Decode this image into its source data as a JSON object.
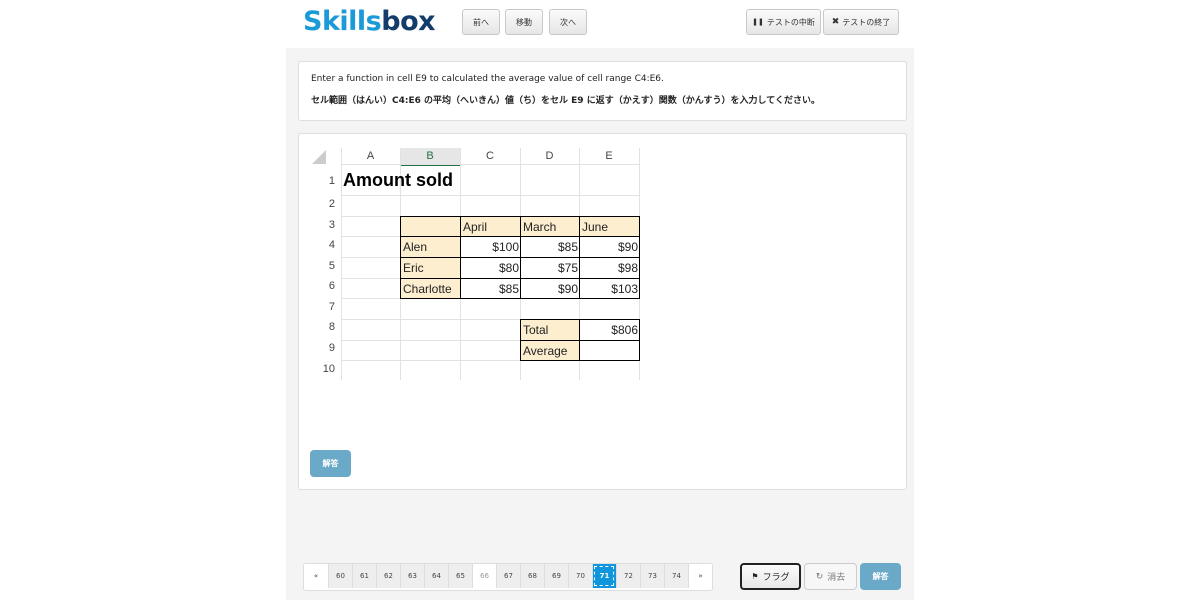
{
  "header": {
    "logo_part1": "Skills",
    "logo_part2": "box",
    "prev_label": "前へ",
    "move_label": "移動",
    "next_label": "次へ",
    "pause_label": "テストの中断",
    "end_label": "テストの終了"
  },
  "question": {
    "english": "Enter a function in cell E9 to calculated the average value of cell range C4:E6.",
    "japanese": "セル範囲（はんい）C4:E6 の平均（へいきん）値（ち）をセル E9 に返す（かえす）関数（かんすう）を入力してください。"
  },
  "sheet": {
    "columns": [
      "A",
      "B",
      "C",
      "D",
      "E"
    ],
    "rows": [
      "1",
      "2",
      "3",
      "4",
      "5",
      "6",
      "7",
      "8",
      "9",
      "10"
    ],
    "title": "Amount sold",
    "month_headers": [
      "April",
      "March",
      "June"
    ],
    "names": [
      "Alen",
      "Eric",
      "Charlotte"
    ],
    "values": [
      [
        "$100",
        "$85",
        "$90"
      ],
      [
        "$80",
        "$75",
        "$98"
      ],
      [
        "$85",
        "$90",
        "$103"
      ]
    ],
    "total_label": "Total",
    "total_value": "$806",
    "average_label": "Average"
  },
  "answer_button_label": "解答",
  "pager": {
    "prev": "«",
    "pages": [
      "60",
      "61",
      "62",
      "63",
      "64",
      "65",
      "66",
      "67",
      "68",
      "69",
      "70",
      "71",
      "72",
      "73",
      "74"
    ],
    "current": "71",
    "next": "»"
  },
  "footer": {
    "flag_label": "フラグ",
    "clear_label": "消去",
    "answer_label": "解答"
  },
  "colors": {
    "brand_light": "#1a9ad6",
    "brand_dark": "#143c6b",
    "cell_fill": "#fdeecf",
    "answer_blue": "#6aaac8",
    "current_page": "#1096dc"
  }
}
